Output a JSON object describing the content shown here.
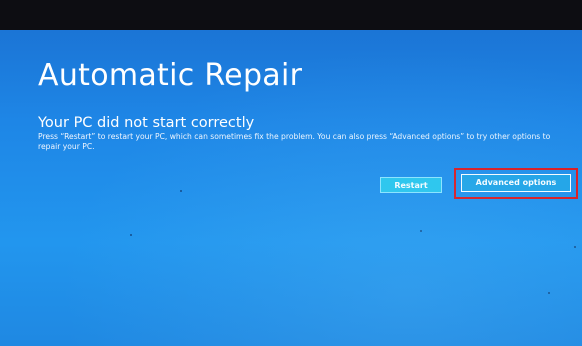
{
  "screen": {
    "title": "Automatic Repair",
    "subtitle": "Your PC did not start correctly",
    "message": "Press “Restart” to restart your PC, which can sometimes fix the problem. You can also press “Advanced options” to try other options to repair your PC."
  },
  "buttons": {
    "restart_label": "Restart",
    "advanced_label": "Advanced options"
  },
  "colors": {
    "background": "#1e86e6",
    "restart_button": "#27c6ec",
    "advanced_button": "#1fa3e6",
    "highlight_box": "#e0151a"
  }
}
